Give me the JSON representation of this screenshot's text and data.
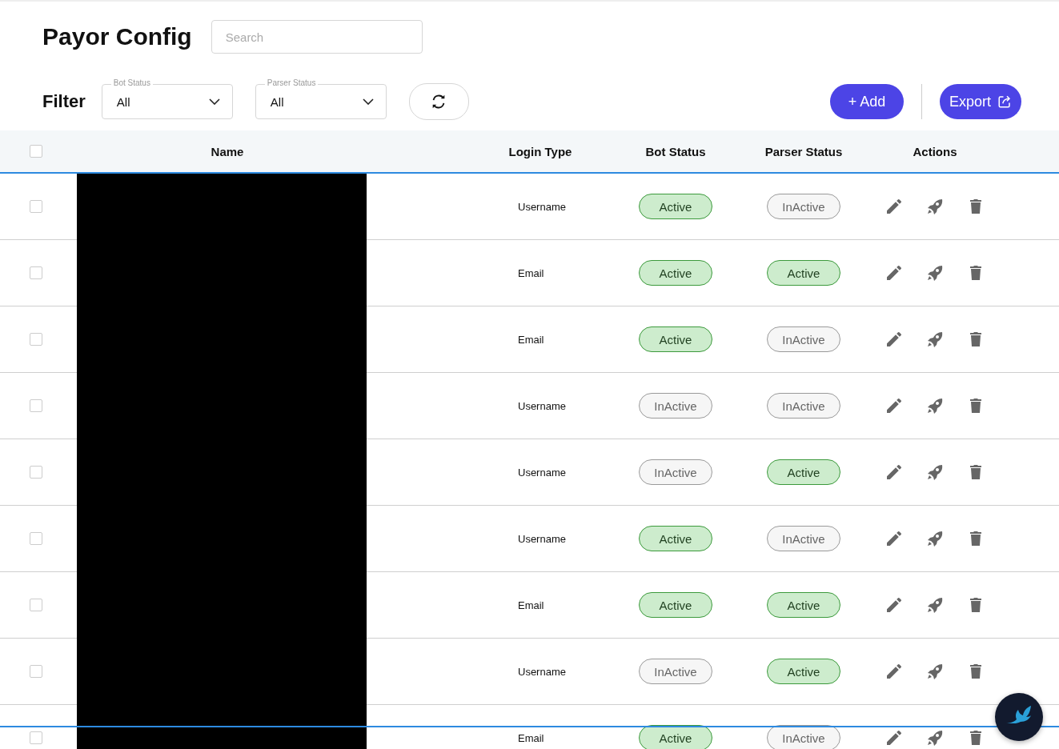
{
  "page": {
    "title": "Payor Config",
    "search": {
      "placeholder": "Search"
    }
  },
  "filter": {
    "label": "Filter",
    "dropdowns": [
      {
        "label": "Bot Status",
        "value": "All"
      },
      {
        "label": "Parser Status",
        "value": "All"
      }
    ]
  },
  "buttons": [
    {
      "kind": "add",
      "label": "+ Add"
    },
    {
      "kind": "export",
      "label": "Export"
    }
  ],
  "table": {
    "select_all": {
      "checked": false
    },
    "columns": [
      "Name",
      "Login Type",
      "Bot Status",
      "Parser Status",
      "Actions"
    ],
    "rows": [
      {
        "checked": false,
        "login_type": "Username",
        "bot_status": {
          "label": "Active",
          "active": true
        },
        "parser_status": {
          "label": "InActive",
          "active": false
        }
      },
      {
        "checked": false,
        "login_type": "Email",
        "bot_status": {
          "label": "Active",
          "active": true
        },
        "parser_status": {
          "label": "Active",
          "active": true
        }
      },
      {
        "checked": false,
        "login_type": "Email",
        "bot_status": {
          "label": "Active",
          "active": true
        },
        "parser_status": {
          "label": "InActive",
          "active": false
        }
      },
      {
        "checked": false,
        "login_type": "Username",
        "bot_status": {
          "label": "InActive",
          "active": false
        },
        "parser_status": {
          "label": "InActive",
          "active": false
        }
      },
      {
        "checked": false,
        "login_type": "Username",
        "bot_status": {
          "label": "InActive",
          "active": false
        },
        "parser_status": {
          "label": "Active",
          "active": true
        }
      },
      {
        "checked": false,
        "login_type": "Username",
        "bot_status": {
          "label": "Active",
          "active": true
        },
        "parser_status": {
          "label": "InActive",
          "active": false
        }
      },
      {
        "checked": false,
        "login_type": "Email",
        "bot_status": {
          "label": "Active",
          "active": true
        },
        "parser_status": {
          "label": "Active",
          "active": true
        }
      },
      {
        "checked": false,
        "login_type": "Username",
        "bot_status": {
          "label": "InActive",
          "active": false
        },
        "parser_status": {
          "label": "Active",
          "active": true
        }
      },
      {
        "checked": false,
        "login_type": "Email",
        "bot_status": {
          "label": "Active",
          "active": true
        },
        "parser_status": {
          "label": "InActive",
          "active": false
        }
      }
    ]
  }
}
